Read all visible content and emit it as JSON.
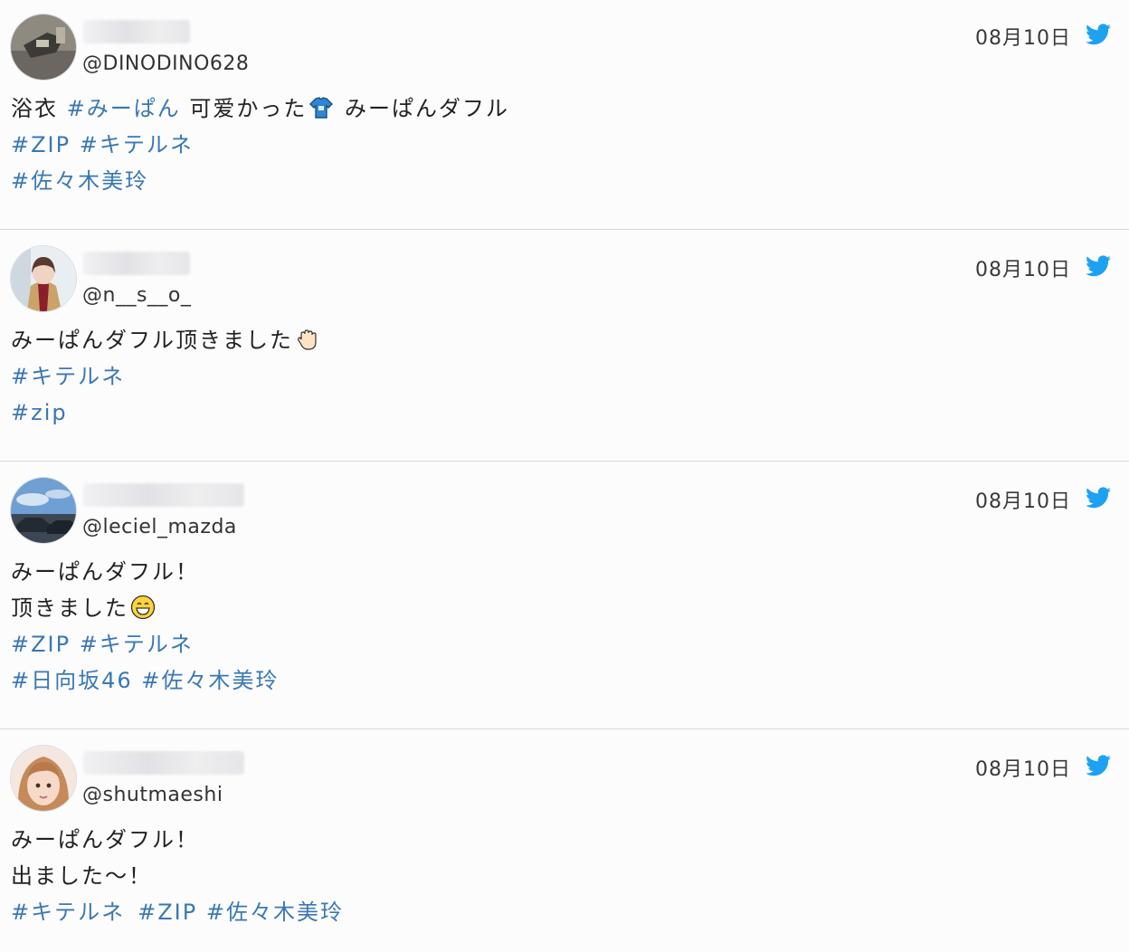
{
  "tweets": [
    {
      "handle": "@DINODINO628",
      "date": "08月10日",
      "line1": {
        "text": "浴衣 ",
        "tag": "#みーぱん",
        "text2": " 可爱かった",
        "emoji": "tshirt",
        "text3": " みーぱんダフル"
      },
      "line2": {
        "tag1": "#ZIP",
        "tag2": "#キテルネ"
      },
      "line3": {
        "tag1": "#佐々木美玲"
      }
    },
    {
      "handle": "@n__s__o_",
      "date": "08月10日",
      "line1": {
        "text": "みーぱんダフル顶きました",
        "emoji": "hand"
      },
      "line2": {
        "tag1": "#キテルネ"
      },
      "line3": {
        "tag1": "#zip"
      }
    },
    {
      "handle": "@leciel_mazda",
      "date": "08月10日",
      "line1": {
        "text": "みーぱんダフル！"
      },
      "line2": {
        "text": "顶きました",
        "emoji": "grin"
      },
      "line3": {
        "tag1": "#ZIP",
        "tag2": "#キテルネ"
      },
      "line4": {
        "tag1": "#日向坂46",
        "tag2": "#佐々木美玲"
      }
    },
    {
      "handle": "@shutmaeshi",
      "date": "08月10日",
      "line1": {
        "text": "みーぱんダフル！"
      },
      "line2": {
        "text": "出ました〜！"
      },
      "line3": {
        "tag1": "#キテルネ",
        "tag2": "#ZIP",
        "tag3": "#佐々木美玲"
      }
    }
  ],
  "colors": {
    "hashtag": "#3a78b4",
    "twitter": "#1da1f2",
    "divider": "#d8d8dc"
  },
  "icons": {
    "source": "twitter-bird-icon"
  }
}
